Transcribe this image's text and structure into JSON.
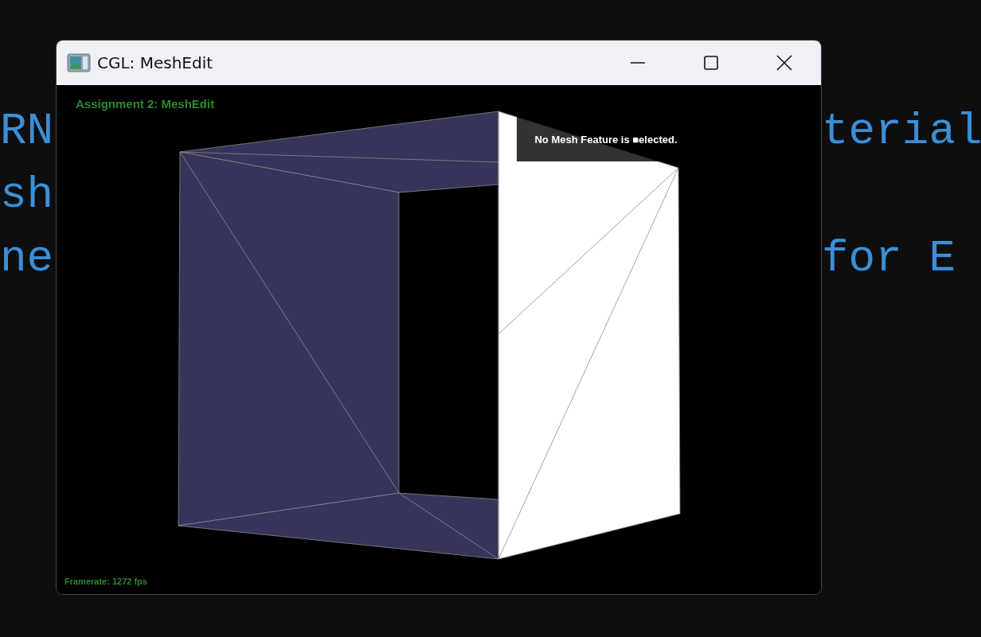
{
  "background_text": {
    "left_lines": [
      "RN",
      "sh",
      "ne"
    ],
    "right_lines": [
      "terial",
      "for E"
    ]
  },
  "window": {
    "title": "CGL: MeshEdit"
  },
  "viewport": {
    "heading": "Assignment 2: MeshEdit",
    "selection_info": "No Mesh Feature is ■elected.",
    "framerate": "Framerate: 1272 fps"
  }
}
